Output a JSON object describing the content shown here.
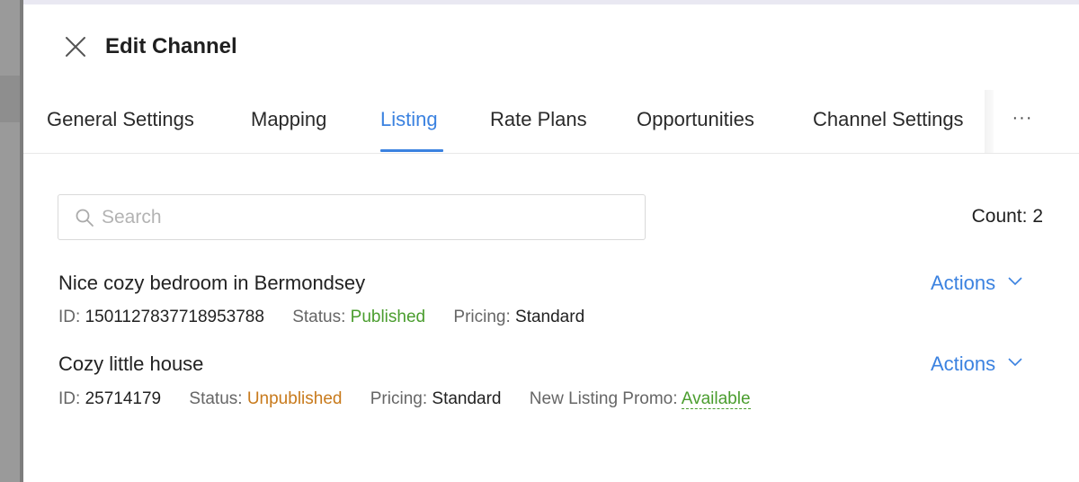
{
  "drawer": {
    "title": "Edit Channel"
  },
  "tabs": [
    {
      "label": "General Settings",
      "active": false
    },
    {
      "label": "Mapping",
      "active": false
    },
    {
      "label": "Listing",
      "active": true
    },
    {
      "label": "Rate Plans",
      "active": false
    },
    {
      "label": "Opportunities",
      "active": false
    },
    {
      "label": "Channel Settings",
      "active": false
    }
  ],
  "more_label": "···",
  "search": {
    "placeholder": "Search",
    "value": ""
  },
  "count": {
    "label": "Count:",
    "value": "2"
  },
  "labels": {
    "id": "ID:",
    "status": "Status:",
    "pricing": "Pricing:",
    "promo": "New Listing Promo:",
    "actions": "Actions"
  },
  "listings": [
    {
      "name": "Nice cozy bedroom in Bermondsey",
      "id": "1501127837718953788",
      "status": "Published",
      "pricing": "Standard"
    },
    {
      "name": "Cozy little house",
      "id": "25714179",
      "status": "Unpublished",
      "pricing": "Standard",
      "promo": "Available"
    }
  ],
  "colors": {
    "accent": "#3b82e0",
    "published": "#4a9d2e",
    "unpublished": "#c87a1c"
  }
}
